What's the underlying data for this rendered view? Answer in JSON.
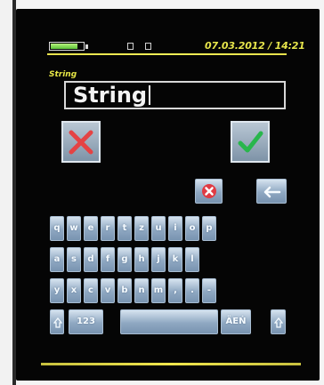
{
  "status": {
    "battery_fill_percent": 84,
    "datetime": "07.03.2012 / 14:21"
  },
  "field": {
    "label": "String",
    "value": "String"
  },
  "actions": {
    "cancel_icon": "close-icon",
    "confirm_icon": "check-icon",
    "cancel_color": "#e44344",
    "confirm_color": "#29b64c"
  },
  "keyboard": {
    "row1": [
      "q",
      "w",
      "e",
      "r",
      "t",
      "z",
      "u",
      "i",
      "o",
      "p"
    ],
    "row2": [
      "a",
      "s",
      "d",
      "f",
      "g",
      "h",
      "j",
      "k",
      "l"
    ],
    "row3": [
      "y",
      "x",
      "c",
      "v",
      "b",
      "n",
      "m",
      ",",
      ".",
      "-"
    ],
    "numeric_label": "123",
    "language_label": "ÄEŃ"
  }
}
